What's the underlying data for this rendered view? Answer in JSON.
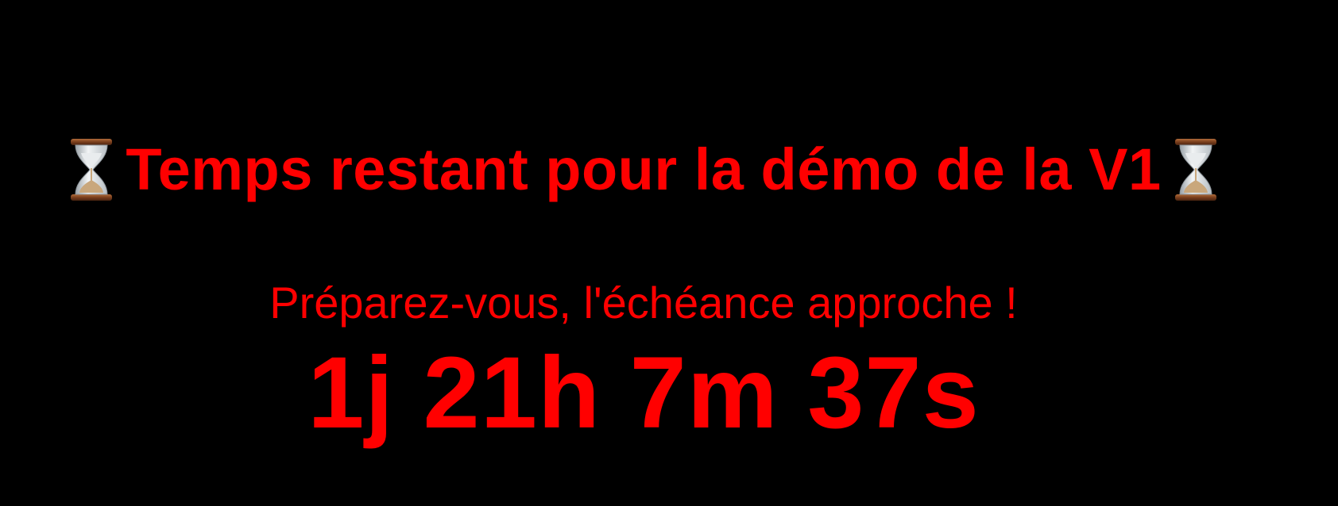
{
  "page": {
    "background_color": "#000000",
    "accent_color": "#ff0000"
  },
  "header": {
    "left_icon": "hourglass-icon",
    "title": "Temps restant pour la démo de la V1",
    "right_icon": "hourglass-icon"
  },
  "message": {
    "subtitle": "Préparez-vous, l'échéance approche !"
  },
  "countdown": {
    "text": "1j 21h 7m 37s"
  }
}
